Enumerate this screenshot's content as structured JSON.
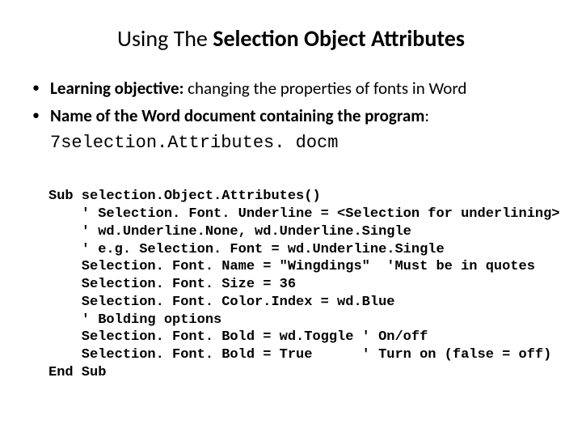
{
  "title": {
    "prefix": "Using The ",
    "strong": "Selection Object Attributes"
  },
  "bullets": [
    {
      "label": "Learning objective:",
      "text": " changing the properties of fonts in Word"
    },
    {
      "label": "Name of the Word document containing the program",
      "text": ":"
    }
  ],
  "filename": "7selection.Attributes. docm",
  "code": {
    "l1": "Sub selection.Object.Attributes()",
    "l2": "    ' Selection. Font. Underline = <Selection for underlining>",
    "l3": "    ' wd.Underline.None, wd.Underline.Single",
    "l4": "    ' e.g. Selection. Font = wd.Underline.Single",
    "l5": "    Selection. Font. Name = \"Wingdings\"  'Must be in quotes",
    "l6": "    Selection. Font. Size = 36",
    "l7": "    Selection. Font. Color.Index = wd.Blue",
    "l8": "    ' Bolding options",
    "l9": "    Selection. Font. Bold = wd.Toggle ' On/off",
    "l10": "    Selection. Font. Bold = True      ' Turn on (false = off)",
    "l11": "End Sub"
  }
}
